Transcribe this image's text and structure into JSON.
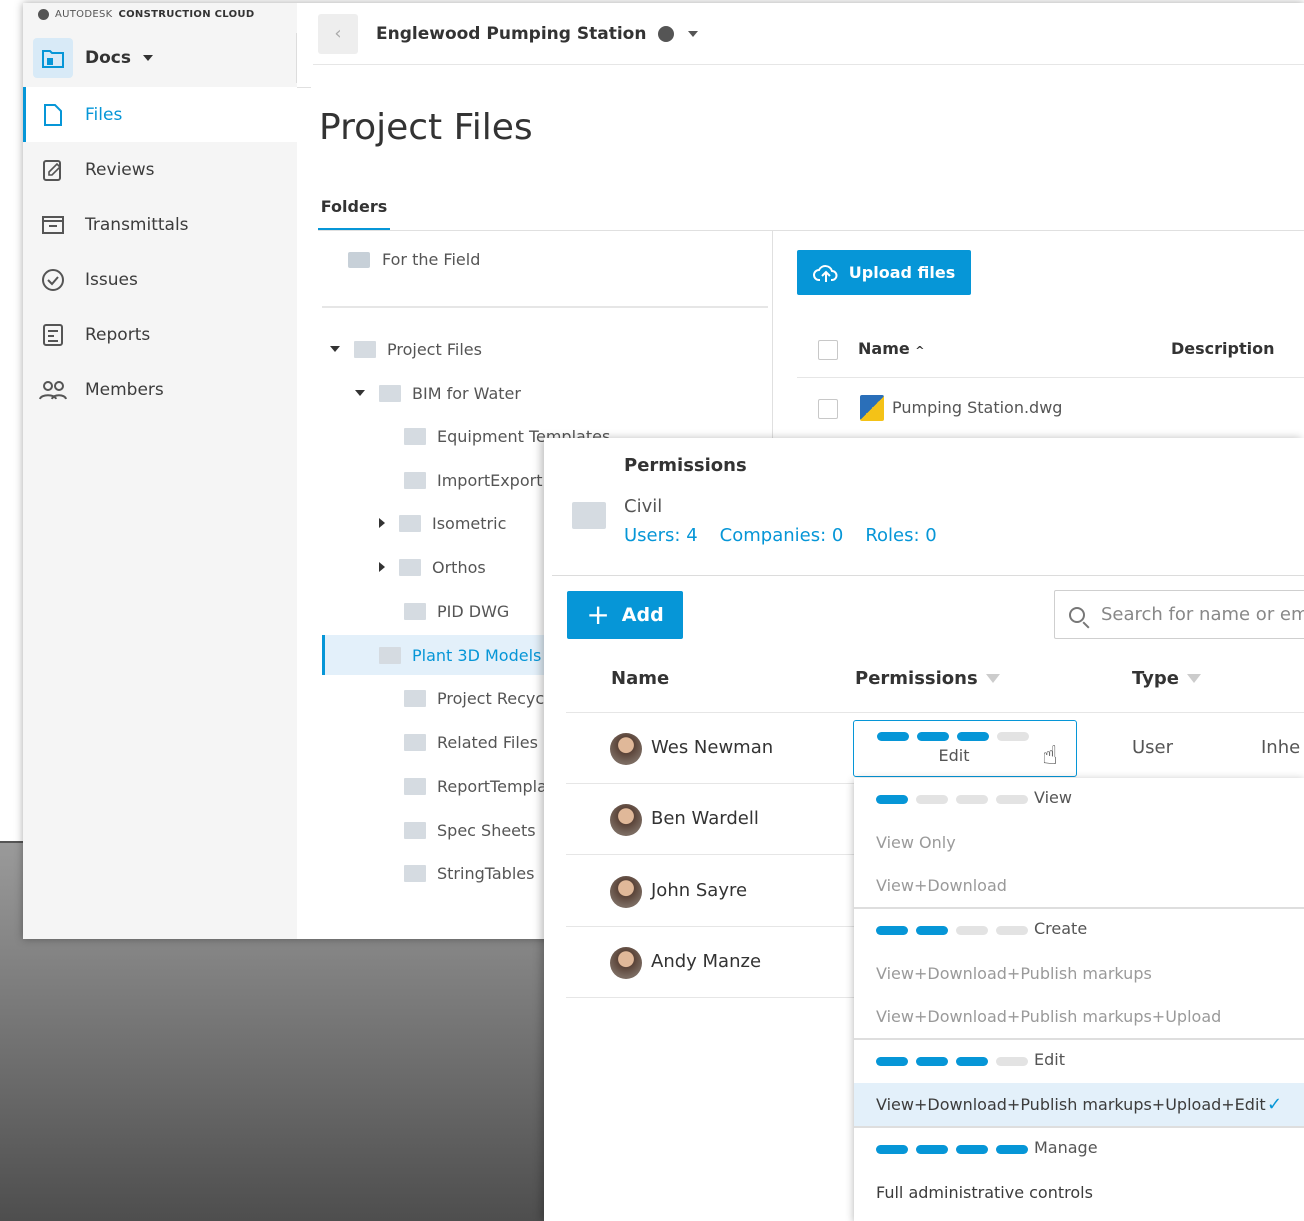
{
  "brand": {
    "prefix": "AUTODESK",
    "product": "CONSTRUCTION CLOUD"
  },
  "app": {
    "module": "Docs"
  },
  "sidebar": {
    "items": [
      {
        "label": "Files",
        "icon": "file-icon",
        "active": true
      },
      {
        "label": "Reviews",
        "icon": "reviews-icon"
      },
      {
        "label": "Transmittals",
        "icon": "transmittals-icon"
      },
      {
        "label": "Issues",
        "icon": "issues-icon"
      },
      {
        "label": "Reports",
        "icon": "reports-icon"
      },
      {
        "label": "Members",
        "icon": "members-icon"
      }
    ]
  },
  "topbar": {
    "project": "Englewood Pumping Station"
  },
  "page": {
    "title": "Project Files",
    "tab": "Folders"
  },
  "tree": {
    "for_field": "For the Field",
    "items": [
      "Project Files",
      "BIM for Water",
      "Equipment Templates",
      "ImportExport",
      "Isometric",
      "Orthos",
      "PID DWG",
      "Plant 3D Models",
      "Project Recycle",
      "Related Files",
      "ReportTemplates",
      "Spec Sheets",
      "StringTables"
    ]
  },
  "files": {
    "upload_label": "Upload files",
    "col_name": "Name",
    "col_desc": "Description",
    "rows": [
      {
        "name": "Pumping Station.dwg"
      }
    ]
  },
  "permissions": {
    "title": "Permissions",
    "folder": "Civil",
    "stats": {
      "users": "Users: 4",
      "companies": "Companies: 0",
      "roles": "Roles: 0"
    },
    "add_label": "Add",
    "search_placeholder": "Search for name or email",
    "columns": {
      "name": "Name",
      "permissions": "Permissions",
      "type": "Type"
    },
    "users": [
      {
        "name": "Wes Newman",
        "type": "User",
        "inherit": "Inhe"
      },
      {
        "name": "Ben Wardell"
      },
      {
        "name": "John Sayre"
      },
      {
        "name": "Andy Manze"
      }
    ],
    "selected": {
      "label": "Edit",
      "level": 3,
      "of": 4
    },
    "dropdown": [
      {
        "group": "View",
        "level": 1,
        "options": [
          "View Only",
          "View+Download"
        ]
      },
      {
        "group": "Create",
        "level": 2,
        "options": [
          "View+Download+Publish markups",
          "View+Download+Publish markups+Upload"
        ]
      },
      {
        "group": "Edit",
        "level": 3,
        "options": [
          "View+Download+Publish markups+Upload+Edit"
        ],
        "selected_option": "View+Download+Publish markups+Upload+Edit"
      },
      {
        "group": "Manage",
        "level": 4,
        "options": [
          "Full administrative controls"
        ]
      }
    ]
  },
  "colors": {
    "accent": "#0696d7",
    "sidebar_bg": "#f5f5f5"
  }
}
